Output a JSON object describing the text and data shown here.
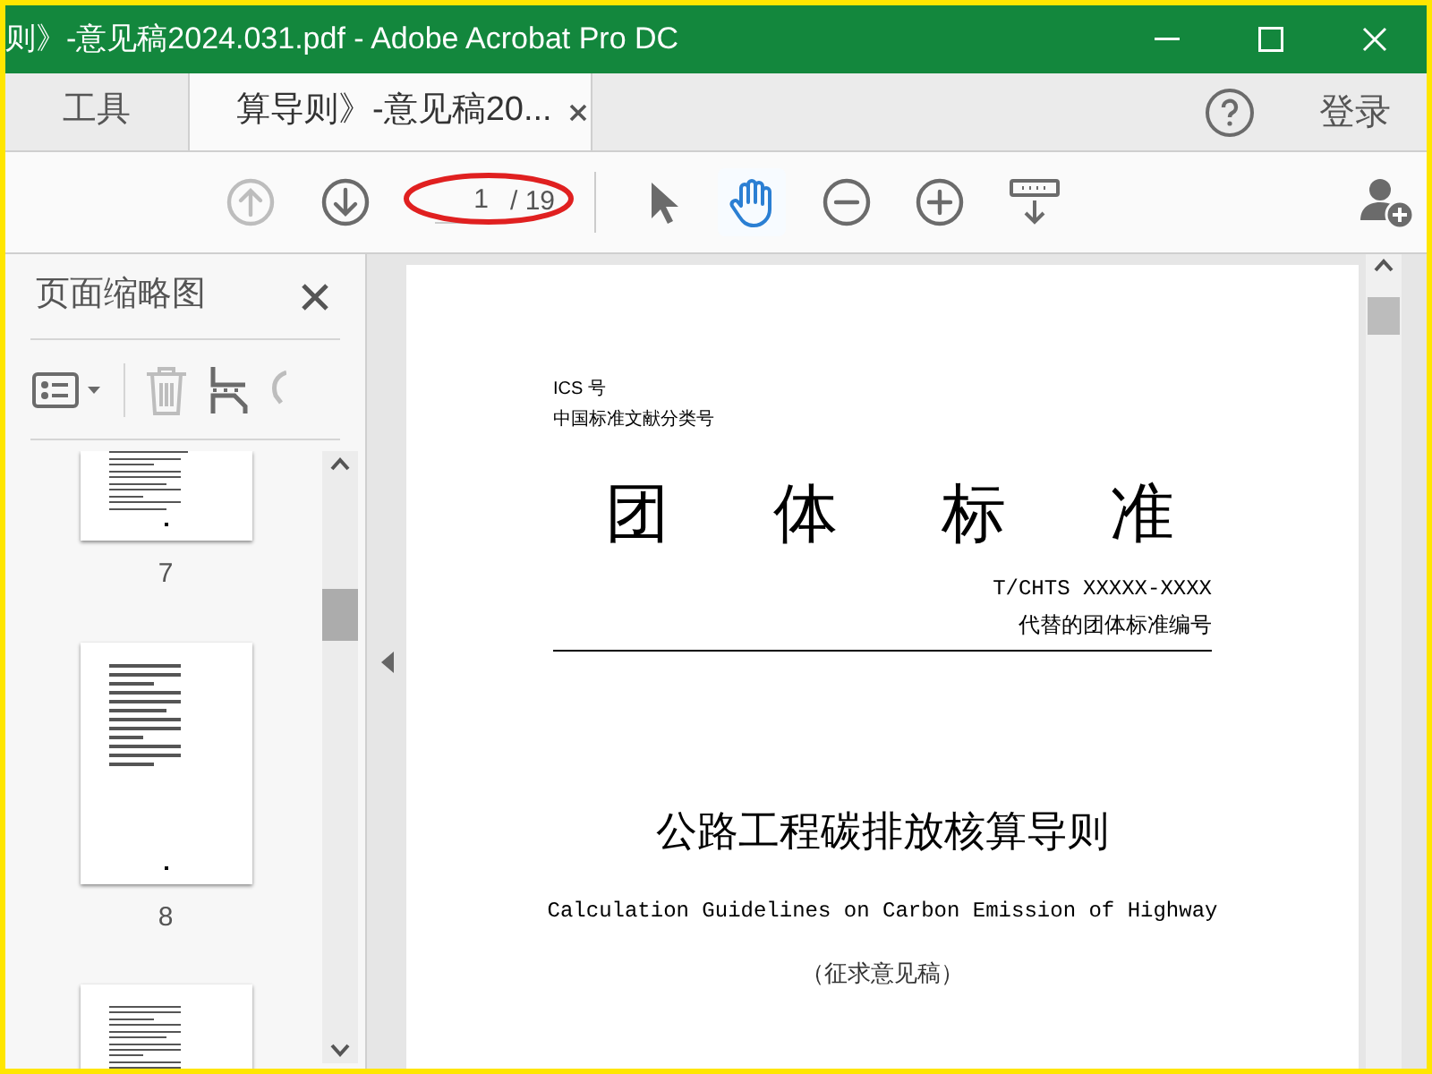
{
  "window": {
    "title": "则》-意见稿2024.031.pdf - Adobe Acrobat Pro DC"
  },
  "tabs": [
    {
      "label": "工具",
      "selected": false
    },
    {
      "label": "算导则》-意见稿20...",
      "selected": true
    }
  ],
  "account": {
    "login": "登录"
  },
  "toolbar": {
    "nav_buttons": [
      {
        "kind": "up",
        "disabled": true
      },
      {
        "kind": "down",
        "disabled": false
      }
    ],
    "page_number": "1",
    "page_total": "/ 19",
    "tools": [
      {
        "kind": "pointer",
        "selected": false
      },
      {
        "kind": "hand",
        "selected": true
      },
      {
        "kind": "zoom-out",
        "selected": false
      },
      {
        "kind": "zoom-in",
        "selected": false
      },
      {
        "kind": "fit",
        "selected": false
      }
    ]
  },
  "thumbnail_panel": {
    "title": "页面缩略图",
    "thumbnails": [
      {
        "label": "7",
        "cut_off_top": true,
        "cut_off_bottom": false
      },
      {
        "label": "8",
        "cut_off_top": false,
        "cut_off_bottom": false
      },
      {
        "cut_off_top": false,
        "cut_off_bottom": true
      }
    ]
  },
  "document": {
    "ics": "ICS 号",
    "classification": "中国标准文献分类号",
    "heading": "团体标准",
    "code": "T/CHTS XXXXX-XXXX",
    "replaces": "代替的团体标准编号",
    "title": "公路工程碳排放核算导则",
    "english_title": "Calculation Guidelines on Carbon Emission of Highway",
    "note": "（征求意见稿）"
  }
}
